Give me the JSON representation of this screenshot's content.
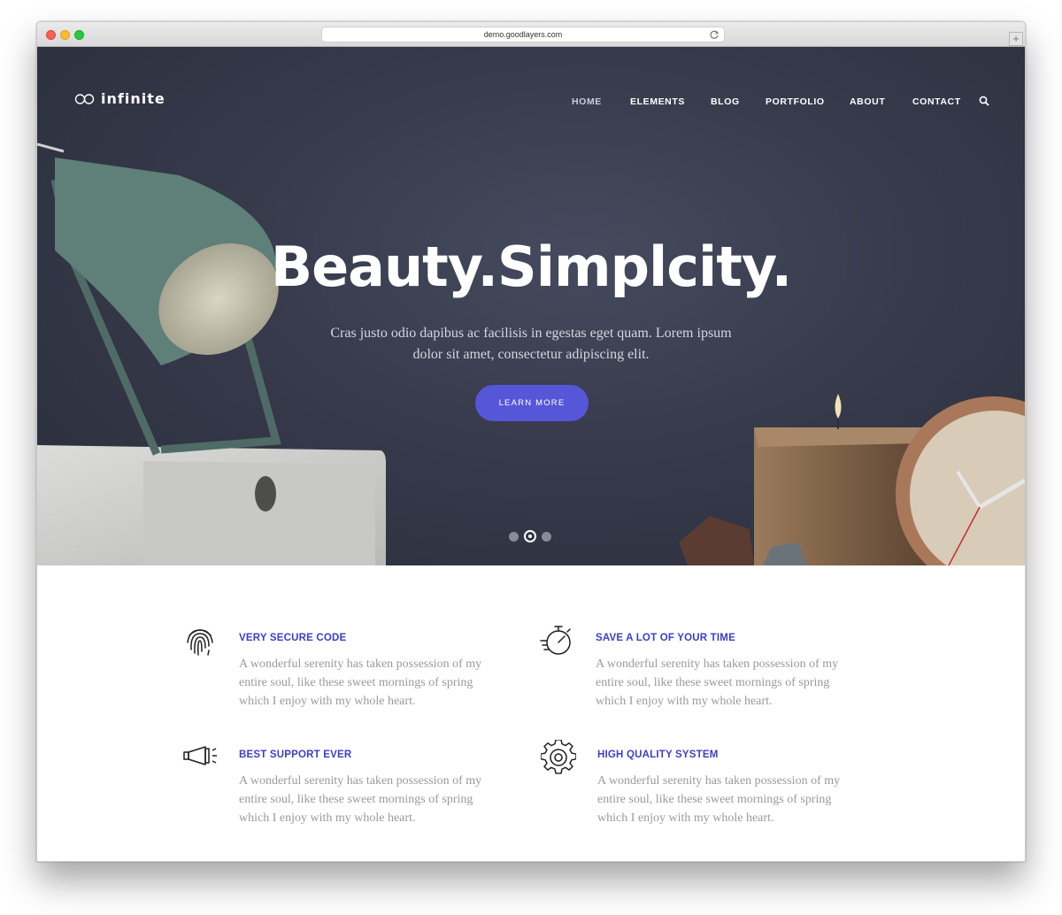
{
  "browser": {
    "url": "demo.goodlayers.com"
  },
  "site": {
    "logo_text": "infinite"
  },
  "nav": {
    "items": [
      {
        "label": "HOME",
        "active": true
      },
      {
        "label": "ELEMENTS"
      },
      {
        "label": "BLOG"
      },
      {
        "label": "PORTFOLIO"
      },
      {
        "label": "ABOUT"
      },
      {
        "label": "CONTACT"
      }
    ]
  },
  "hero": {
    "title": "Beauty.Simplcity.",
    "text": "Cras justo odio dapibus ac facilisis in egestas eget quam. Lorem ipsum dolor sit amet, consectetur adipiscing elit.",
    "button_label": "LEARN MORE",
    "slides": 3,
    "active_slide": 2
  },
  "features": [
    {
      "icon": "fingerprint-icon",
      "title": "VERY SECURE CODE",
      "text": "A wonderful serenity has taken possession of my entire soul, like these sweet mornings of spring which I enjoy with my whole heart."
    },
    {
      "icon": "stopwatch-icon",
      "title": "SAVE A LOT OF YOUR TIME",
      "text": "A wonderful serenity has taken possession of my entire soul, like these sweet mornings of spring which I enjoy with my whole heart."
    },
    {
      "icon": "megaphone-icon",
      "title": "BEST SUPPORT EVER",
      "text": "A wonderful serenity has taken possession of my entire soul, like these sweet mornings of spring which I enjoy with my whole heart."
    },
    {
      "icon": "gear-icon",
      "title": "HIGH QUALITY SYSTEM",
      "text": "A wonderful serenity has taken possession of my entire soul, like these sweet mornings of spring which I enjoy with my whole heart."
    }
  ],
  "colors": {
    "accent": "#5656d8",
    "feature_title": "#3d3dc9",
    "hero_bg": "#363a4b"
  }
}
